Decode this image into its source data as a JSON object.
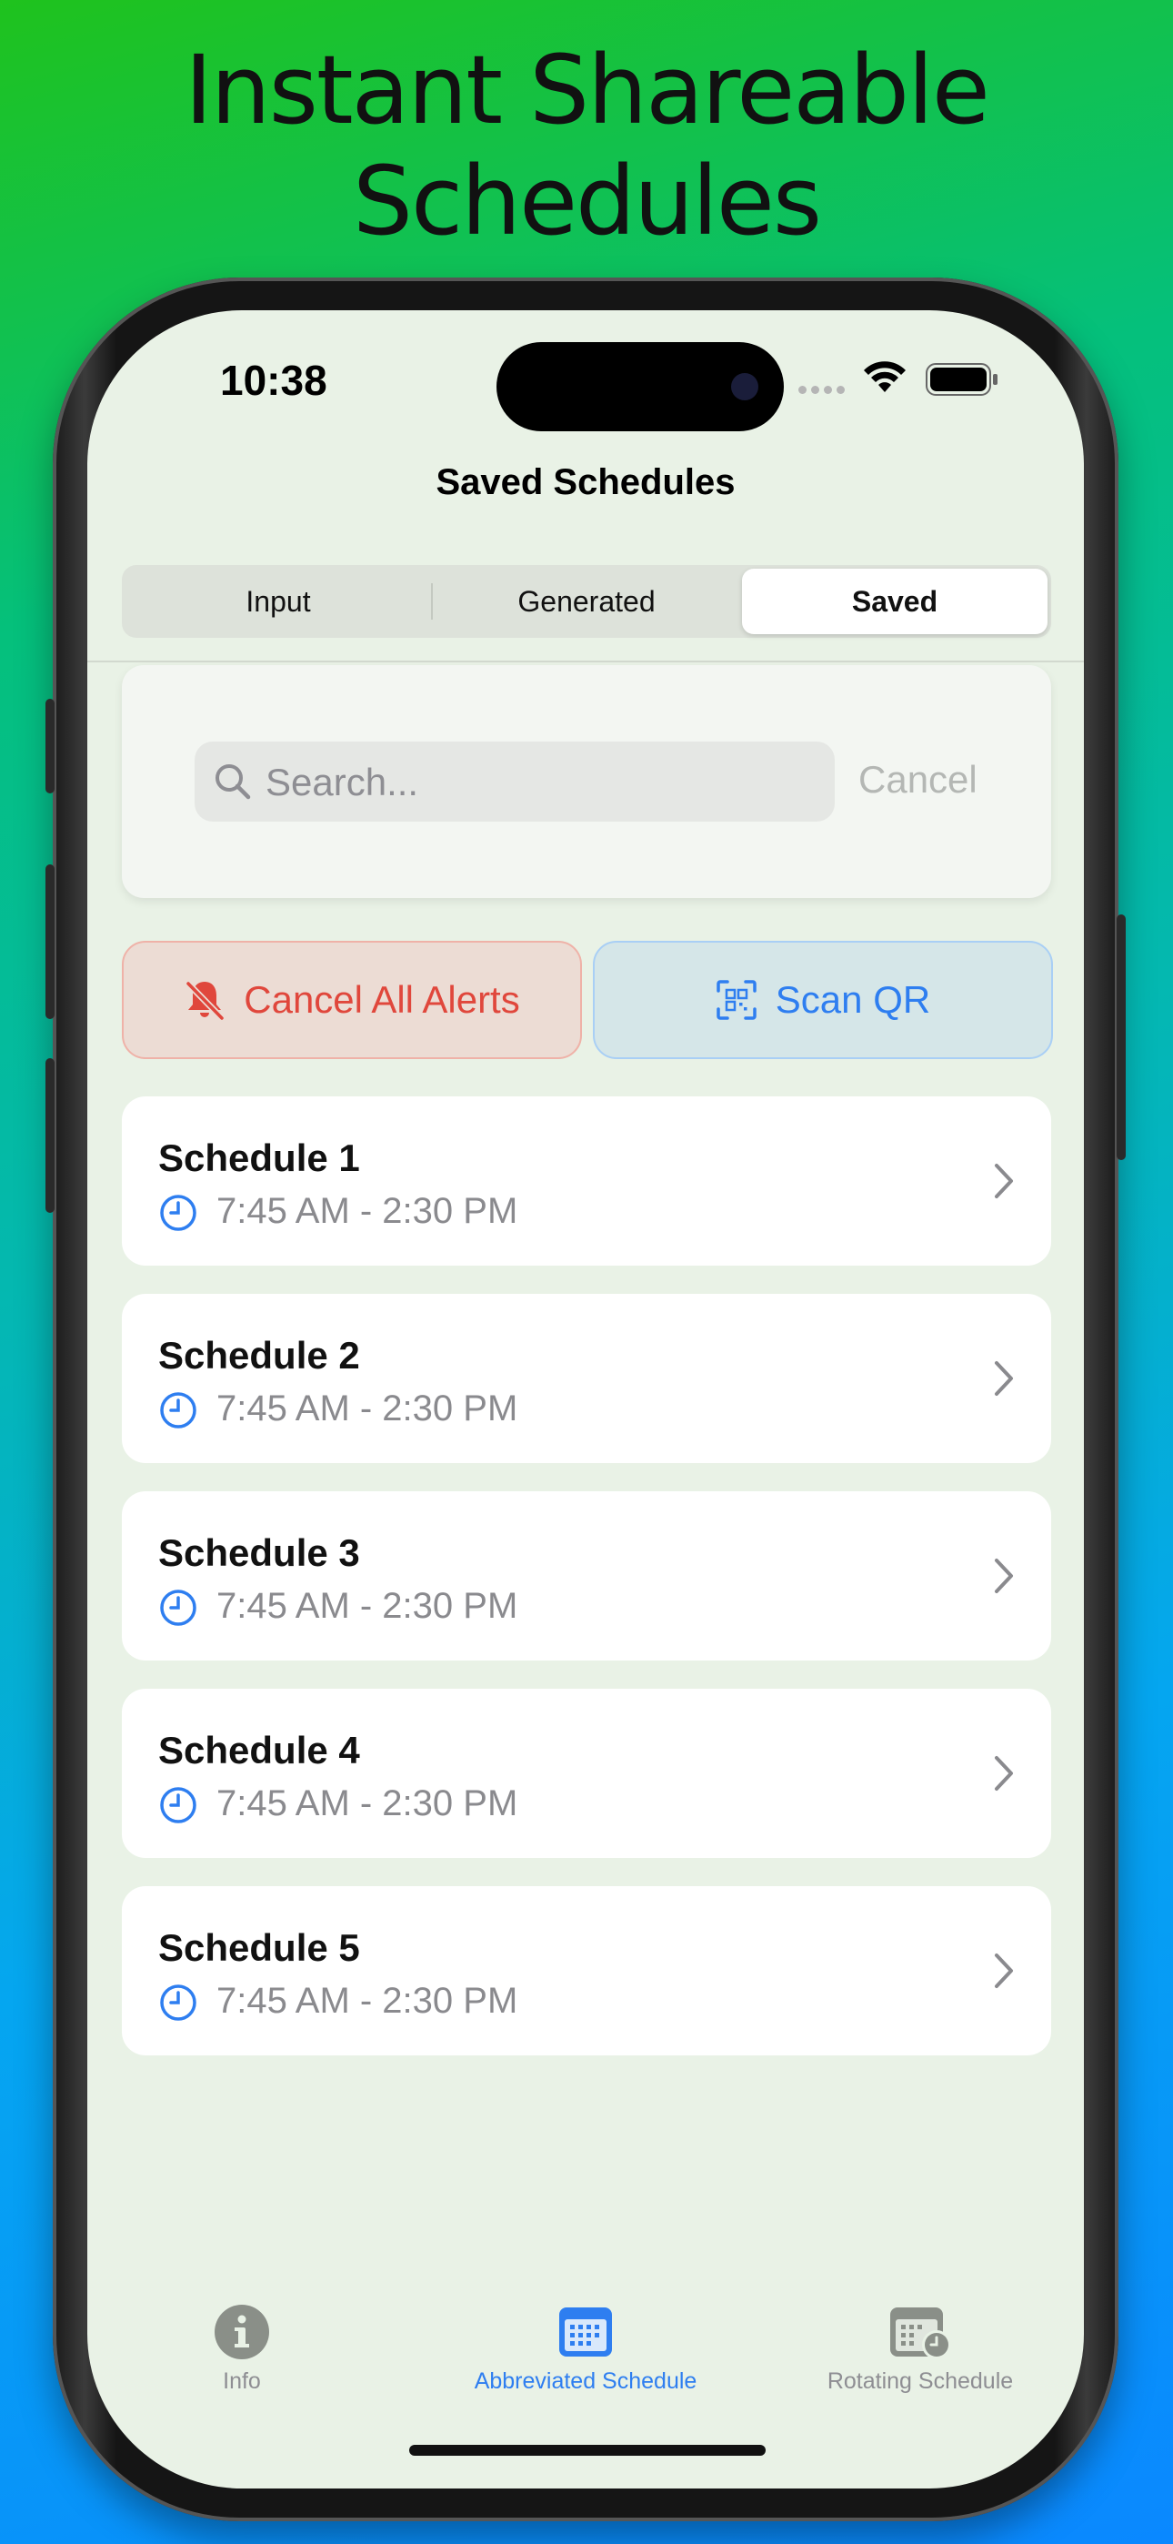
{
  "headline": {
    "line1": "Instant Shareable",
    "line2": "Schedules"
  },
  "status_bar": {
    "time": "10:38"
  },
  "nav": {
    "title": "Saved Schedules"
  },
  "segments": [
    {
      "label": "Input",
      "active": false
    },
    {
      "label": "Generated",
      "active": false
    },
    {
      "label": "Saved",
      "active": true
    }
  ],
  "search": {
    "placeholder": "Search...",
    "cancel_label": "Cancel"
  },
  "actions": {
    "cancel_alerts": "Cancel All Alerts",
    "scan_qr": "Scan QR"
  },
  "schedules": [
    {
      "name": "Schedule 1",
      "time": "7:45 AM - 2:30 PM"
    },
    {
      "name": "Schedule 2",
      "time": "7:45 AM - 2:30 PM"
    },
    {
      "name": "Schedule 3",
      "time": "7:45 AM - 2:30 PM"
    },
    {
      "name": "Schedule 4",
      "time": "7:45 AM - 2:30 PM"
    },
    {
      "name": "Schedule 5",
      "time": "7:45 AM - 2:30 PM"
    }
  ],
  "tabbar": [
    {
      "label": "Info",
      "icon": "info-icon",
      "active": false
    },
    {
      "label": "Abbreviated Schedule",
      "icon": "calendar-icon",
      "active": true
    },
    {
      "label": "Rotating Schedule",
      "icon": "calendar-clock-icon",
      "active": false
    }
  ],
  "colors": {
    "accent": "#2e7ef0",
    "danger": "#e0473c",
    "screen_bg": "#e9f2e6"
  }
}
